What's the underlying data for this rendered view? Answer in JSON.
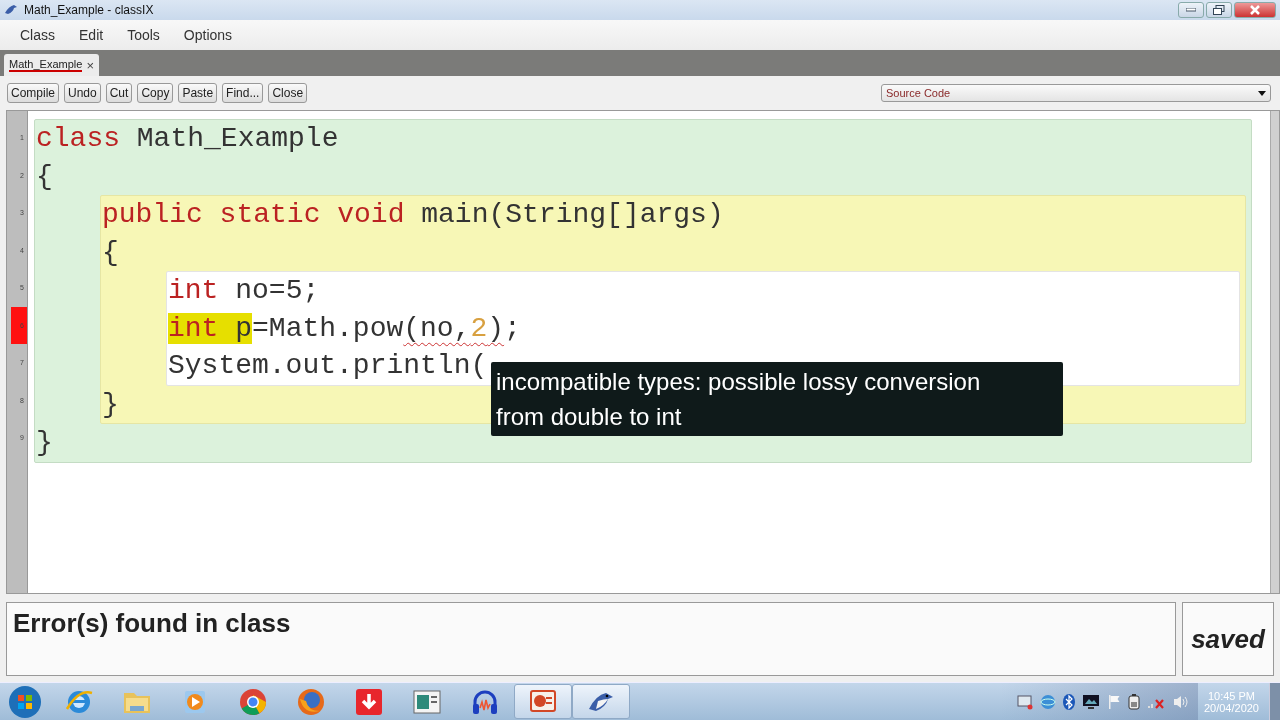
{
  "window": {
    "title": "Math_Example - classIX"
  },
  "menu": [
    "Class",
    "Edit",
    "Tools",
    "Options"
  ],
  "tabs": [
    {
      "label": "Math_Example",
      "close": "×",
      "selected": true
    }
  ],
  "toolbar": [
    "Compile",
    "Undo",
    "Cut",
    "Copy",
    "Paste",
    "Find...",
    "Close"
  ],
  "view_select": {
    "value": "Source Code"
  },
  "editor": {
    "line_numbers": [
      {
        "number": "1",
        "error": false
      },
      {
        "number": "2",
        "error": false
      },
      {
        "number": "3",
        "error": false
      },
      {
        "number": "4",
        "error": false
      },
      {
        "number": "5",
        "error": false
      },
      {
        "number": "6",
        "error": true
      },
      {
        "number": "7",
        "error": false
      },
      {
        "number": "8",
        "error": false
      },
      {
        "number": "9",
        "error": false
      }
    ],
    "scope": {
      "kind": "class",
      "items": [
        {
          "segments": [
            {
              "text": "class",
              "kind": "keyword",
              "highlighted": false,
              "error": false
            },
            {
              "text": " Math_Example",
              "kind": "plain",
              "highlighted": false,
              "error": false
            }
          ]
        },
        {
          "segments": [
            {
              "text": "{",
              "kind": "plain",
              "highlighted": false,
              "error": false
            }
          ]
        },
        {
          "kind": "method",
          "items": [
            {
              "segments": [
                {
                  "text": "public static void",
                  "kind": "keyword",
                  "highlighted": false,
                  "error": false
                },
                {
                  "text": " main(String[]args)",
                  "kind": "plain",
                  "highlighted": false,
                  "error": false
                }
              ]
            },
            {
              "segments": [
                {
                  "text": "{",
                  "kind": "plain",
                  "highlighted": false,
                  "error": false
                }
              ]
            },
            {
              "kind": "body",
              "items": [
                {
                  "segments": [
                    {
                      "text": "int",
                      "kind": "keyword",
                      "highlighted": false,
                      "error": false
                    },
                    {
                      "text": " no=5;",
                      "kind": "plain",
                      "highlighted": false,
                      "error": false
                    }
                  ]
                },
                {
                  "segments": [
                    {
                      "text": "int",
                      "kind": "keyword",
                      "highlighted": true,
                      "error": false
                    },
                    {
                      "text": " p",
                      "kind": "plain",
                      "highlighted": true,
                      "error": false
                    },
                    {
                      "text": "=Math.pow",
                      "kind": "plain",
                      "highlighted": false,
                      "error": false
                    },
                    {
                      "text": "(no,",
                      "kind": "plain",
                      "highlighted": false,
                      "error": true
                    },
                    {
                      "text": "2",
                      "kind": "number",
                      "highlighted": false,
                      "error": true
                    },
                    {
                      "text": ")",
                      "kind": "plain",
                      "highlighted": false,
                      "error": true
                    },
                    {
                      "text": ";",
                      "kind": "plain",
                      "highlighted": false,
                      "error": false
                    }
                  ]
                },
                {
                  "segments": [
                    {
                      "text": "System.out.println(",
                      "kind": "plain",
                      "highlighted": false,
                      "error": false
                    }
                  ]
                }
              ]
            },
            {
              "segments": [
                {
                  "text": "}",
                  "kind": "plain",
                  "highlighted": false,
                  "error": false
                }
              ]
            }
          ]
        },
        {
          "segments": [
            {
              "text": "}",
              "kind": "plain",
              "highlighted": false,
              "error": false
            }
          ]
        }
      ]
    }
  },
  "tooltip": "incompatible types: possible lossy conversion from double to int",
  "status": {
    "message": "Error(s) found in class",
    "saved": "saved"
  },
  "taskbar": {
    "apps": [
      {
        "kind": "browser-e",
        "active": false
      },
      {
        "kind": "folder",
        "active": false
      },
      {
        "kind": "media",
        "active": false
      },
      {
        "kind": "chrome",
        "active": false
      },
      {
        "kind": "firefox",
        "active": false
      },
      {
        "kind": "download",
        "active": false
      },
      {
        "kind": "window",
        "active": false
      },
      {
        "kind": "headphones",
        "active": false
      },
      {
        "kind": "slides",
        "active": true
      },
      {
        "kind": "bird",
        "active": true
      }
    ],
    "tray": [
      {
        "kind": "monitor"
      },
      {
        "kind": "globe"
      },
      {
        "kind": "bluetooth"
      },
      {
        "kind": "display"
      },
      {
        "kind": "flag"
      },
      {
        "kind": "battery"
      },
      {
        "kind": "network"
      },
      {
        "kind": "speaker"
      }
    ],
    "time": "10:45 PM",
    "date": "20/04/2020"
  }
}
